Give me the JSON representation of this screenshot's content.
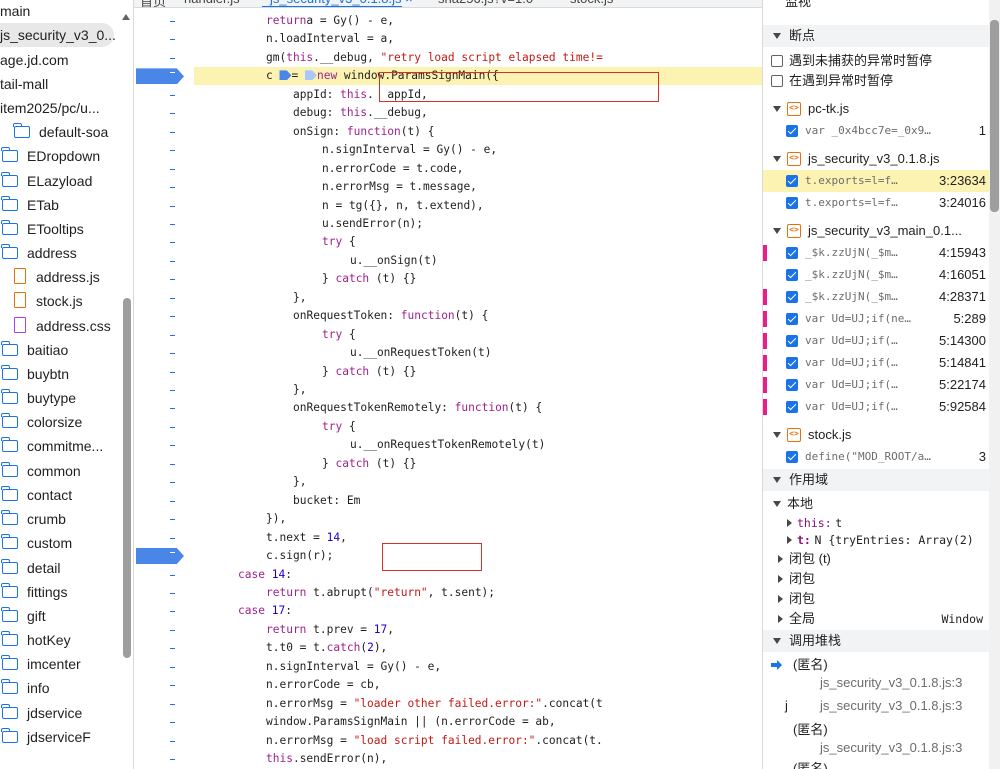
{
  "file_tree": {
    "items": [
      {
        "label": "main",
        "type": "text",
        "indent": 0
      },
      {
        "label": "js_security_v3_0...",
        "type": "text",
        "indent": 0,
        "selected": true
      },
      {
        "label": "age.jd.com",
        "type": "text",
        "indent": 0
      },
      {
        "label": "tail-mall",
        "type": "text",
        "indent": 0
      },
      {
        "label": "item2025/pc/u...",
        "type": "text",
        "indent": 0
      },
      {
        "label": "default-soa",
        "type": "folder",
        "indent": 12
      },
      {
        "label": "EDropdown",
        "type": "folder",
        "indent": 0
      },
      {
        "label": "ELazyload",
        "type": "folder",
        "indent": 0
      },
      {
        "label": "ETab",
        "type": "folder",
        "indent": 0
      },
      {
        "label": "ETooltips",
        "type": "folder",
        "indent": 0
      },
      {
        "label": "address",
        "type": "folder",
        "indent": 0
      },
      {
        "label": "address.js",
        "type": "js",
        "indent": 14
      },
      {
        "label": "stock.js",
        "type": "js",
        "indent": 14
      },
      {
        "label": "address.css",
        "type": "css",
        "indent": 14
      },
      {
        "label": "baitiao",
        "type": "folder",
        "indent": 0
      },
      {
        "label": "buybtn",
        "type": "folder",
        "indent": 0
      },
      {
        "label": "buytype",
        "type": "folder",
        "indent": 0
      },
      {
        "label": "colorsize",
        "type": "folder",
        "indent": 0
      },
      {
        "label": "commitme...",
        "type": "folder",
        "indent": 0
      },
      {
        "label": "common",
        "type": "folder",
        "indent": 0
      },
      {
        "label": "contact",
        "type": "folder",
        "indent": 0
      },
      {
        "label": "crumb",
        "type": "folder",
        "indent": 0
      },
      {
        "label": "custom",
        "type": "folder",
        "indent": 0
      },
      {
        "label": "detail",
        "type": "folder",
        "indent": 0
      },
      {
        "label": "fittings",
        "type": "folder",
        "indent": 0
      },
      {
        "label": "gift",
        "type": "folder",
        "indent": 0
      },
      {
        "label": "hotKey",
        "type": "folder",
        "indent": 0
      },
      {
        "label": "imcenter",
        "type": "folder",
        "indent": 0
      },
      {
        "label": "info",
        "type": "folder",
        "indent": 0
      },
      {
        "label": "jdservice",
        "type": "folder",
        "indent": 0
      },
      {
        "label": "jdserviceF",
        "type": "folder",
        "indent": 0
      }
    ]
  },
  "editor": {
    "tabs": [
      {
        "label": "首页",
        "active": false
      },
      {
        "label": "handler.js",
        "active": false
      },
      {
        "label": "js_security_v3_0.1.8.js ×",
        "active": true
      },
      {
        "label": "sha256.js?v=1.0",
        "active": false
      },
      {
        "label": "stock.js",
        "active": false
      }
    ],
    "lines": [
      {
        "indent": 2,
        "tokens": [
          [
            "kw",
            "return"
          ],
          [
            "",
            "a = Gy() - e,"
          ]
        ]
      },
      {
        "indent": 2,
        "tokens": [
          [
            "",
            "n.loadInterval = a,"
          ]
        ]
      },
      {
        "indent": 2,
        "tokens": [
          [
            "",
            "gm("
          ],
          [
            "kw",
            "this"
          ],
          [
            "",
            "."
          ],
          [
            "",
            "__debug, "
          ],
          [
            "str",
            "\"retry load script elapsed time!="
          ]
        ]
      },
      {
        "indent": 2,
        "tokens": [
          [
            "",
            "c "
          ],
          [
            "arrow",
            ""
          ],
          [
            "",
            "= "
          ],
          [
            "arrowlight",
            ""
          ],
          [
            "kw",
            "new"
          ],
          [
            "",
            " window.ParamsSignMain({"
          ]
        ],
        "highlight": true
      },
      {
        "indent": 3,
        "tokens": [
          [
            "",
            "appId: "
          ],
          [
            "kw",
            "this"
          ],
          [
            "",
            ".  appId,"
          ]
        ]
      },
      {
        "indent": 3,
        "tokens": [
          [
            "",
            "debug: "
          ],
          [
            "kw",
            "this"
          ],
          [
            "",
            ".__debug,"
          ]
        ]
      },
      {
        "indent": 3,
        "tokens": [
          [
            "",
            "onSign: "
          ],
          [
            "kw",
            "function"
          ],
          [
            "",
            "(t) {"
          ]
        ]
      },
      {
        "indent": 4,
        "tokens": [
          [
            "",
            "n.signInterval = Gy() - e,"
          ]
        ]
      },
      {
        "indent": 4,
        "tokens": [
          [
            "",
            "n.errorCode = t.code,"
          ]
        ]
      },
      {
        "indent": 4,
        "tokens": [
          [
            "",
            "n.errorMsg = t.message,"
          ]
        ]
      },
      {
        "indent": 4,
        "tokens": [
          [
            "",
            "n = tg({}, n, t.extend),"
          ]
        ]
      },
      {
        "indent": 4,
        "tokens": [
          [
            "",
            "u.sendError(n);"
          ]
        ]
      },
      {
        "indent": 4,
        "tokens": [
          [
            "kw",
            "try"
          ],
          [
            "",
            " {"
          ]
        ]
      },
      {
        "indent": 5,
        "tokens": [
          [
            "",
            "u.__onSign(t)"
          ]
        ]
      },
      {
        "indent": 4,
        "tokens": [
          [
            "",
            "} "
          ],
          [
            "kw",
            "catch"
          ],
          [
            "",
            " (t) {}"
          ]
        ]
      },
      {
        "indent": 3,
        "tokens": [
          [
            "",
            "},"
          ]
        ]
      },
      {
        "indent": 3,
        "tokens": [
          [
            "",
            "onRequestToken: "
          ],
          [
            "kw",
            "function"
          ],
          [
            "",
            "(t) {"
          ]
        ]
      },
      {
        "indent": 4,
        "tokens": [
          [
            "kw",
            "try"
          ],
          [
            "",
            " {"
          ]
        ]
      },
      {
        "indent": 5,
        "tokens": [
          [
            "",
            "u.__onRequestToken(t)"
          ]
        ]
      },
      {
        "indent": 4,
        "tokens": [
          [
            "",
            "} "
          ],
          [
            "kw",
            "catch"
          ],
          [
            "",
            " (t) {}"
          ]
        ]
      },
      {
        "indent": 3,
        "tokens": [
          [
            "",
            "},"
          ]
        ]
      },
      {
        "indent": 3,
        "tokens": [
          [
            "",
            "onRequestTokenRemotely: "
          ],
          [
            "kw",
            "function"
          ],
          [
            "",
            "(t) {"
          ]
        ]
      },
      {
        "indent": 4,
        "tokens": [
          [
            "kw",
            "try"
          ],
          [
            "",
            " {"
          ]
        ]
      },
      {
        "indent": 5,
        "tokens": [
          [
            "",
            "u.__onRequestTokenRemotely(t)"
          ]
        ]
      },
      {
        "indent": 4,
        "tokens": [
          [
            "",
            "} "
          ],
          [
            "kw",
            "catch"
          ],
          [
            "",
            " (t) {}"
          ]
        ]
      },
      {
        "indent": 3,
        "tokens": [
          [
            "",
            "},"
          ]
        ]
      },
      {
        "indent": 3,
        "tokens": [
          [
            "",
            "bucket: Em"
          ]
        ]
      },
      {
        "indent": 2,
        "tokens": [
          [
            "",
            "}),"
          ]
        ]
      },
      {
        "indent": 2,
        "tokens": [
          [
            "",
            "t.next = "
          ],
          [
            "num",
            "14"
          ],
          [
            "",
            ","
          ]
        ]
      },
      {
        "indent": 2,
        "tokens": [
          [
            "",
            "c.sign(r);"
          ]
        ]
      },
      {
        "indent": 1,
        "tokens": [
          [
            "kw",
            "case"
          ],
          [
            "",
            " "
          ],
          [
            "num",
            "14"
          ],
          [
            "",
            ":"
          ]
        ]
      },
      {
        "indent": 2,
        "tokens": [
          [
            "kw",
            "return"
          ],
          [
            "",
            " t.abrupt("
          ],
          [
            "str",
            "\"return\""
          ],
          [
            "",
            ", t.sent);"
          ]
        ]
      },
      {
        "indent": 1,
        "tokens": [
          [
            "kw",
            "case"
          ],
          [
            "",
            " "
          ],
          [
            "num",
            "17"
          ],
          [
            "",
            ":"
          ]
        ]
      },
      {
        "indent": 2,
        "tokens": [
          [
            "kw",
            "return"
          ],
          [
            "",
            " t.prev = "
          ],
          [
            "num",
            "17"
          ],
          [
            "",
            ","
          ]
        ]
      },
      {
        "indent": 2,
        "tokens": [
          [
            "",
            "t.t0 = t."
          ],
          [
            "kw",
            "catch"
          ],
          [
            "",
            "("
          ],
          [
            "num",
            "2"
          ],
          [
            "",
            "),"
          ]
        ]
      },
      {
        "indent": 2,
        "tokens": [
          [
            "",
            "n.signInterval = Gy() - e,"
          ]
        ]
      },
      {
        "indent": 2,
        "tokens": [
          [
            "",
            "n.errorCode = cb,"
          ]
        ]
      },
      {
        "indent": 2,
        "tokens": [
          [
            "",
            "n.errorMsg = "
          ],
          [
            "str",
            "\"loader other failed.error:\""
          ],
          [
            "",
            ".concat(t"
          ]
        ]
      },
      {
        "indent": 2,
        "tokens": [
          [
            "",
            "window.ParamsSignMain || (n.errorCode = ab,"
          ]
        ]
      },
      {
        "indent": 2,
        "tokens": [
          [
            "",
            "n.errorMsg = "
          ],
          [
            "str",
            "\"load script failed.error:\""
          ],
          [
            "",
            ".concat(t."
          ]
        ]
      },
      {
        "indent": 2,
        "tokens": [
          [
            "kw",
            "this"
          ],
          [
            "",
            ".sendError(n),"
          ]
        ]
      }
    ]
  },
  "sidebar": {
    "watch_label": "监视",
    "breakpoints_label": "断点",
    "pause_uncaught": "遇到未捕获的异常时暂停",
    "pause_caught": "在遇到异常时暂停",
    "bp_files": [
      {
        "name": "pc-tk.js",
        "rows": [
          {
            "code": "var _0x4bcc7e=_0x9…",
            "loc": "1",
            "pink": false,
            "current": false
          }
        ]
      },
      {
        "name": "js_security_v3_0.1.8.js",
        "rows": [
          {
            "code": "t.exports=l=f…",
            "loc": "3:23634",
            "pink": false,
            "current": true
          },
          {
            "code": "t.exports=l=f…",
            "loc": "3:24016",
            "pink": false,
            "current": false
          }
        ]
      },
      {
        "name": "js_security_v3_main_0.1...",
        "rows": [
          {
            "code": "_$k.zzUjN(_$m…",
            "loc": "4:15943",
            "pink": true,
            "current": false
          },
          {
            "code": "_$k.zzUjN(_$m…",
            "loc": "4:16051",
            "pink": false,
            "current": false
          },
          {
            "code": "_$k.zzUjN(_$m…",
            "loc": "4:28371",
            "pink": true,
            "current": false
          },
          {
            "code": "var Ud=UJ;if(ne…",
            "loc": "5:289",
            "pink": true,
            "current": false
          },
          {
            "code": "var Ud=UJ;if(…",
            "loc": "5:14300",
            "pink": true,
            "current": false
          },
          {
            "code": "var Ud=UJ;if(…",
            "loc": "5:14841",
            "pink": true,
            "current": false
          },
          {
            "code": "var Ud=UJ;if(…",
            "loc": "5:22174",
            "pink": true,
            "current": false
          },
          {
            "code": "var Ud=UJ;if(…",
            "loc": "5:92584",
            "pink": true,
            "current": false
          }
        ]
      },
      {
        "name": "stock.js",
        "rows": [
          {
            "code": "define(\"MOD_ROOT/a…",
            "loc": "3",
            "pink": false,
            "current": false
          }
        ]
      }
    ],
    "scope_label": "作用域",
    "scope_local": "本地",
    "scope_this_key": "this:",
    "scope_this_val": "t",
    "scope_t_key": "t:",
    "scope_t_val": "N  {tryEntries: Array(2)",
    "closure_t": "闭包 (t)",
    "closure1": "闭包",
    "closure2": "闭包",
    "global": "全局",
    "global_val": "Window",
    "callstack_label": "调用堆栈",
    "stack": [
      {
        "name": "(匿名)",
        "loc": "js_security_v3_0.1.8.js:3",
        "current": true
      },
      {
        "name": "j",
        "loc": "js_security_v3_0.1.8.js:3",
        "current": false
      },
      {
        "name": "(匿名)",
        "loc": "js_security_v3_0.1.8.js:3",
        "current": false
      },
      {
        "name": "(匿名)",
        "loc": "",
        "current": false
      }
    ]
  },
  "colors": {
    "accent": "#1a73e8",
    "highlight": "#fcf3b2",
    "keyword": "#a0228e",
    "string": "#c41a16",
    "number": "#1c00cf",
    "annotation_box": "#d93025",
    "breakpoint": "#4a86e8"
  }
}
